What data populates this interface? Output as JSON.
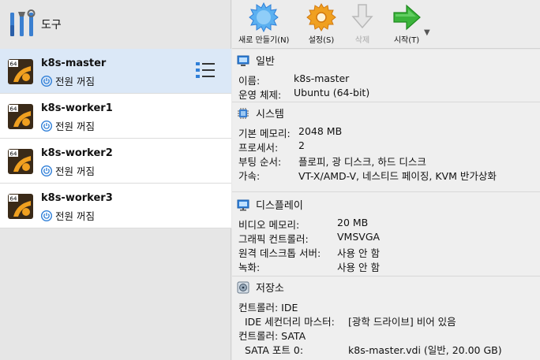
{
  "sidebar": {
    "tools_label": "도구",
    "vms": [
      {
        "name": "k8s-master",
        "state": "전원 꺼짐",
        "os_badge": "64",
        "selected": true
      },
      {
        "name": "k8s-worker1",
        "state": "전원 꺼짐",
        "os_badge": "64",
        "selected": false
      },
      {
        "name": "k8s-worker2",
        "state": "전원 꺼짐",
        "os_badge": "64",
        "selected": false
      },
      {
        "name": "k8s-worker3",
        "state": "전원 꺼짐",
        "os_badge": "64",
        "selected": false
      }
    ]
  },
  "toolbar": {
    "new_label": "새로 만들기(N)",
    "settings_label": "설정(S)",
    "delete_label": "삭제",
    "start_label": "시작(T)",
    "more_glyph": "▼"
  },
  "details": {
    "general": {
      "title": "일반",
      "rows": [
        {
          "key": "이름:",
          "value": "k8s-master"
        },
        {
          "key": "운영 체제:",
          "value": "Ubuntu (64-bit)"
        }
      ]
    },
    "system": {
      "title": "시스템",
      "rows": [
        {
          "key": "기본 메모리:",
          "value": "2048 MB"
        },
        {
          "key": "프로세서:",
          "value": "2"
        },
        {
          "key": "부팅 순서:",
          "value": "플로피, 광 디스크, 하드 디스크"
        },
        {
          "key": "가속:",
          "value": "VT-X/AMD-V, 네스티드 페이징, KVM 반가상화"
        }
      ]
    },
    "display": {
      "title": "디스플레이",
      "rows": [
        {
          "key": "비디오 메모리:",
          "value": "20 MB"
        },
        {
          "key": "그래픽 컨트롤러:",
          "value": "VMSVGA"
        },
        {
          "key": "원격 데스크톱 서버:",
          "value": "사용 안 함"
        },
        {
          "key": "녹화:",
          "value": "사용 안 함"
        }
      ]
    },
    "storage": {
      "title": "저장소",
      "rows": [
        {
          "key": "컨트롤러: IDE",
          "value": ""
        },
        {
          "key": "IDE 세컨더리 마스터:",
          "value": "[광학 드라이브] 비어 있음"
        },
        {
          "key": "컨트롤러: SATA",
          "value": ""
        },
        {
          "key": "SATA 포트 0:",
          "value": "k8s-master.vdi (일반, 20.00 GB)"
        }
      ]
    }
  },
  "colors": {
    "selection": "#dbe8f7",
    "accent_blue": "#2f7fd8",
    "start_green": "#3bb43b",
    "settings_orange": "#f0a020"
  }
}
